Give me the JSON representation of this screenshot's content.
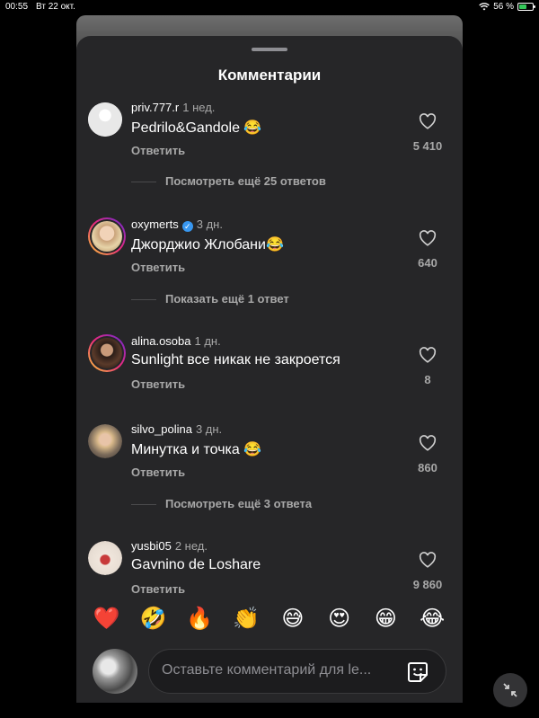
{
  "status_bar": {
    "time": "00:55",
    "date": "Вт 22 окт.",
    "battery": "56 %",
    "battery_level": 0.56
  },
  "sheet": {
    "title": "Комментарии"
  },
  "comments": [
    {
      "user": "priv.777.r",
      "ago": "1 нед.",
      "text": "Pedrilo&Gandole 😂",
      "reply": "Ответить",
      "likes": "5 410",
      "verified": false,
      "avatar": "blank-avatar"
    },
    {
      "user": "oxymerts",
      "ago": "3 дн.",
      "text": "Джорджио Жлобани😂",
      "reply": "Ответить",
      "likes": "640",
      "verified": true,
      "avatar": "story-ring-avatar"
    },
    {
      "user": "alina.osoba",
      "ago": "1 дн.",
      "text": "Sunlight все никак не закроется",
      "reply": "Ответить",
      "likes": "8",
      "verified": false,
      "avatar": "story-ring-avatar"
    },
    {
      "user": "silvo_polina",
      "ago": "3 дн.",
      "text": "Минутка и точка 😂",
      "reply": "Ответить",
      "likes": "860",
      "verified": false,
      "avatar": "photo-avatar"
    },
    {
      "user": "yusbi05",
      "ago": "2 нед.",
      "text": "Gavnino de Loshare",
      "reply": "Ответить",
      "likes": "9 860",
      "verified": false,
      "avatar": "photo-avatar"
    }
  ],
  "more_links": [
    "Посмотреть ещё 25 ответов",
    "Показать ещё 1 ответ",
    "Посмотреть ещё 3 ответа"
  ],
  "emoji_bar": [
    "❤️",
    "🤣",
    "🔥",
    "👏",
    "😅",
    "😍",
    "😁",
    "😂"
  ],
  "composer": {
    "placeholder": "Оставьте комментарий для le..."
  },
  "colors": {
    "sheet": "#262628",
    "muted": "#a8a8a8",
    "accent": "#3897f0"
  }
}
